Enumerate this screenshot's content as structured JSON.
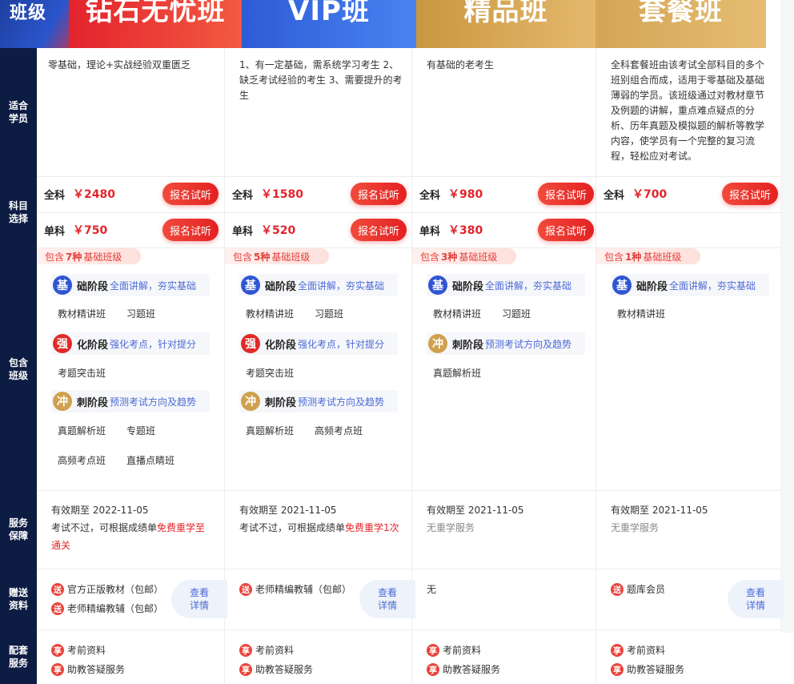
{
  "corner": "班级",
  "headers": [
    "钻石无忧班",
    "VIP班",
    "精品班",
    "套餐班"
  ],
  "row_labels": [
    "适合学员",
    "科目选择",
    "包含班级",
    "服务保障",
    "赠送资料",
    "配套服务"
  ],
  "columns": [
    {
      "desc": "零基础，理论+实战经验双重匮乏",
      "prices": [
        {
          "label": "全科",
          "value": "￥2480",
          "button": "报名试听"
        },
        {
          "label": "单科",
          "value": "￥750",
          "button": "报名试听"
        }
      ],
      "tag_prefix": "包含",
      "tag_count": "7种",
      "tag_suffix": "基础班级",
      "stages": [
        {
          "badge": "基",
          "name": "础阶段",
          "desc": "全面讲解，夯实基础",
          "subs": [
            "教材精讲班",
            "习题班"
          ]
        },
        {
          "badge": "强",
          "name": "化阶段",
          "desc": "强化考点，针对提分",
          "subs": [
            "考题突击班"
          ]
        },
        {
          "badge": "冲",
          "name": "刺阶段",
          "desc": "预测考试方向及趋势",
          "subs": [
            "真题解析班",
            "专题班",
            "高频考点班",
            "直播点睛班"
          ]
        }
      ],
      "service_valid": "有效期至 2022-11-05",
      "service_pre": "考试不过，可根据成绩单",
      "service_red": "免费重学至通关",
      "gifts": [
        "官方正版教材（包邮）",
        "老师精编教辅（包邮）"
      ],
      "detail": "查看详情",
      "extras": [
        "考前资料",
        "助教答疑服务"
      ]
    },
    {
      "desc": "1、有一定基础，需系统学习考生 2、缺乏考试经验的考生 3、需要提升的考生",
      "prices": [
        {
          "label": "全科",
          "value": "￥1580",
          "button": "报名试听"
        },
        {
          "label": "单科",
          "value": "￥520",
          "button": "报名试听"
        }
      ],
      "tag_prefix": "包含",
      "tag_count": "5种",
      "tag_suffix": "基础班级",
      "stages": [
        {
          "badge": "基",
          "name": "础阶段",
          "desc": "全面讲解，夯实基础",
          "subs": [
            "教材精讲班",
            "习题班"
          ]
        },
        {
          "badge": "强",
          "name": "化阶段",
          "desc": "强化考点，针对提分",
          "subs": [
            "考题突击班"
          ]
        },
        {
          "badge": "冲",
          "name": "刺阶段",
          "desc": "预测考试方向及趋势",
          "subs": [
            "真题解析班",
            "高频考点班"
          ]
        }
      ],
      "service_valid": "有效期至 2021-11-05",
      "service_pre": "考试不过，可根据成绩单",
      "service_red": "免费重学1次",
      "gifts": [
        "老师精编教辅（包邮）"
      ],
      "detail": "查看详情",
      "extras": [
        "考前资料",
        "助教答疑服务"
      ]
    },
    {
      "desc": "有基础的老考生",
      "prices": [
        {
          "label": "全科",
          "value": "￥980",
          "button": "报名试听"
        },
        {
          "label": "单科",
          "value": "￥380",
          "button": "报名试听"
        }
      ],
      "tag_prefix": "包含",
      "tag_count": "3种",
      "tag_suffix": "基础班级",
      "stages": [
        {
          "badge": "基",
          "name": "础阶段",
          "desc": "全面讲解，夯实基础",
          "subs": [
            "教材精讲班",
            "习题班"
          ]
        },
        {
          "badge": "冲",
          "name": "刺阶段",
          "desc": "预测考试方向及趋势",
          "subs": [
            "真题解析班"
          ]
        }
      ],
      "service_valid": "有效期至 2021-11-05",
      "service_gray": "无重学服务",
      "gift_text": "无",
      "extras": [
        "考前资料",
        "助教答疑服务"
      ]
    },
    {
      "desc": "全科套餐班由该考试全部科目的多个班别组合而成，适用于零基础及基础薄弱的学员。该班级通过对教材章节及例题的讲解，重点难点疑点的分析、历年真题及模拟题的解析等教学内容，使学员有一个完整的复习流程，轻松应对考试。",
      "prices": [
        {
          "label": "全科",
          "value": "￥700",
          "button": "报名试听"
        }
      ],
      "tag_prefix": "包含",
      "tag_count": "1种",
      "tag_suffix": "基础班级",
      "stages": [
        {
          "badge": "基",
          "name": "础阶段",
          "desc": "全面讲解，夯实基础",
          "subs": [
            "教材精讲班"
          ]
        }
      ],
      "service_valid": "有效期至 2021-11-05",
      "service_gray": "无重学服务",
      "gifts": [
        "题库会员"
      ],
      "detail": "查看详情",
      "extras": [
        "考前资料",
        "助教答疑服务"
      ]
    }
  ],
  "dot_labels": {
    "gift": "送",
    "extra": "享"
  }
}
